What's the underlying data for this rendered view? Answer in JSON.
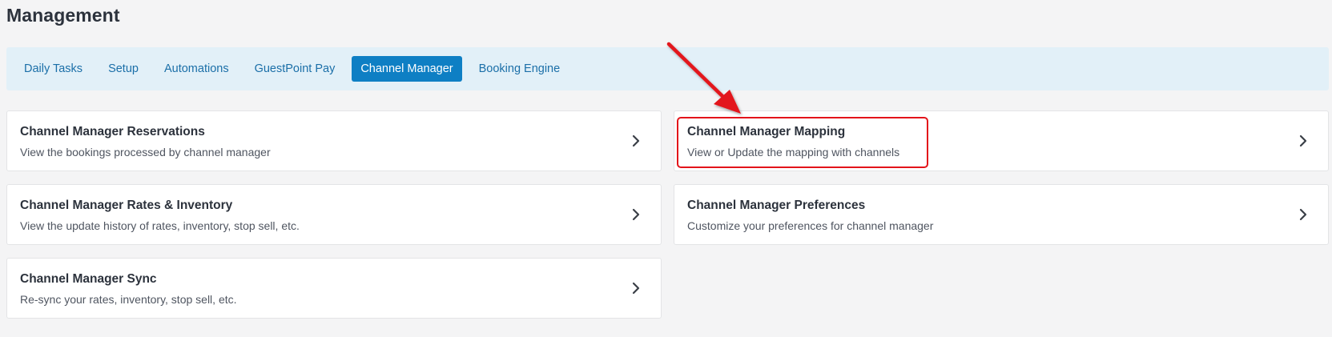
{
  "page": {
    "title": "Management"
  },
  "tabs": [
    {
      "label": "Daily Tasks",
      "active": false
    },
    {
      "label": "Setup",
      "active": false
    },
    {
      "label": "Automations",
      "active": false
    },
    {
      "label": "GuestPoint Pay",
      "active": false
    },
    {
      "label": "Channel Manager",
      "active": true
    },
    {
      "label": "Booking Engine",
      "active": false
    }
  ],
  "cards": [
    {
      "title": "Channel Manager Reservations",
      "description": "View the bookings processed by channel manager",
      "icon": "chevron-right-icon"
    },
    {
      "title": "Channel Manager Mapping",
      "description": "View or Update the mapping with channels",
      "icon": "chevron-right-icon"
    },
    {
      "title": "Channel Manager Rates & Inventory",
      "description": "View the update history of rates, inventory, stop sell, etc.",
      "icon": "chevron-right-icon"
    },
    {
      "title": "Channel Manager Preferences",
      "description": "Customize your preferences for channel manager",
      "icon": "chevron-right-icon"
    },
    {
      "title": "Channel Manager Sync",
      "description": "Re-sync your rates, inventory, stop sell, etc.",
      "icon": "chevron-right-icon"
    }
  ],
  "colors": {
    "accent": "#0e7fc4",
    "tab_text": "#1b6fa8",
    "tabbar_bg": "#e2f0f8",
    "annotation": "#e3141a"
  }
}
